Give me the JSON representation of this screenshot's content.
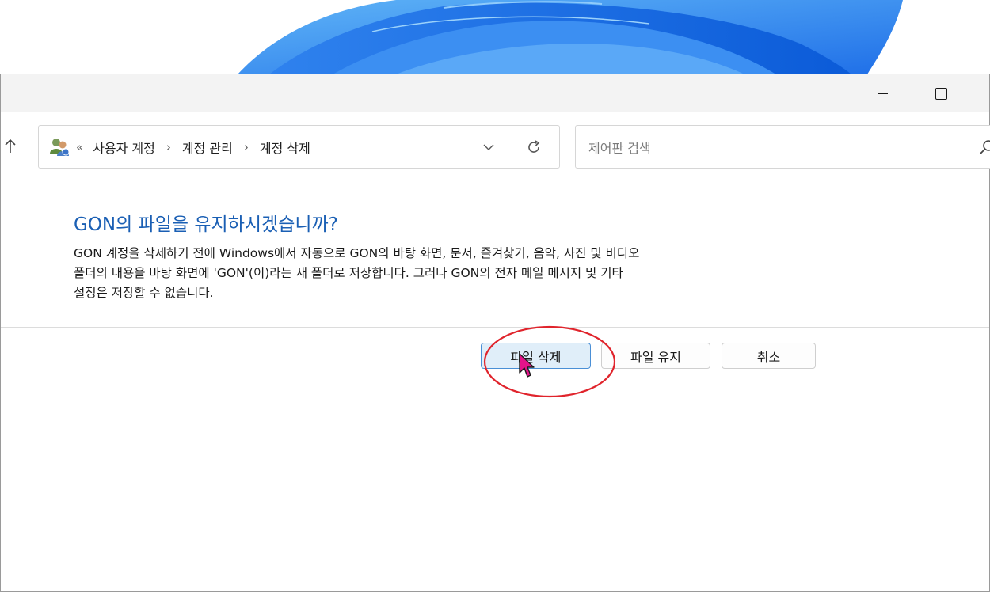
{
  "address_bar": {
    "crumbs": [
      "사용자 계정",
      "계정 관리",
      "계정 삭제"
    ],
    "overflow": "«",
    "icon": "user-accounts-icon"
  },
  "search": {
    "placeholder": "제어판 검색"
  },
  "dialog": {
    "heading": "GON의 파일을 유지하시겠습니까?",
    "description_lines": [
      "GON 계정을 삭제하기 전에 Windows에서 자동으로 GON의 바탕 화면, 문서, 즐겨찾기, 음악, 사진 및 비디오",
      "폴더의 내용을 바탕 화면에 'GON'(이)라는 새 폴더로 저장합니다. 그러나 GON의 전자 메일 메시지 및 기타",
      "설정은 저장할 수 없습니다."
    ]
  },
  "buttons": {
    "delete_files": "파일 삭제",
    "keep_files": "파일 유지",
    "cancel": "취소"
  },
  "colors": {
    "heading": "#1a5fb4",
    "annotation": "#e0242c",
    "cursor": "#e4148a",
    "primary_button_bg": "#e0eef9",
    "wallpaper_blue": "#1f6fe8"
  }
}
